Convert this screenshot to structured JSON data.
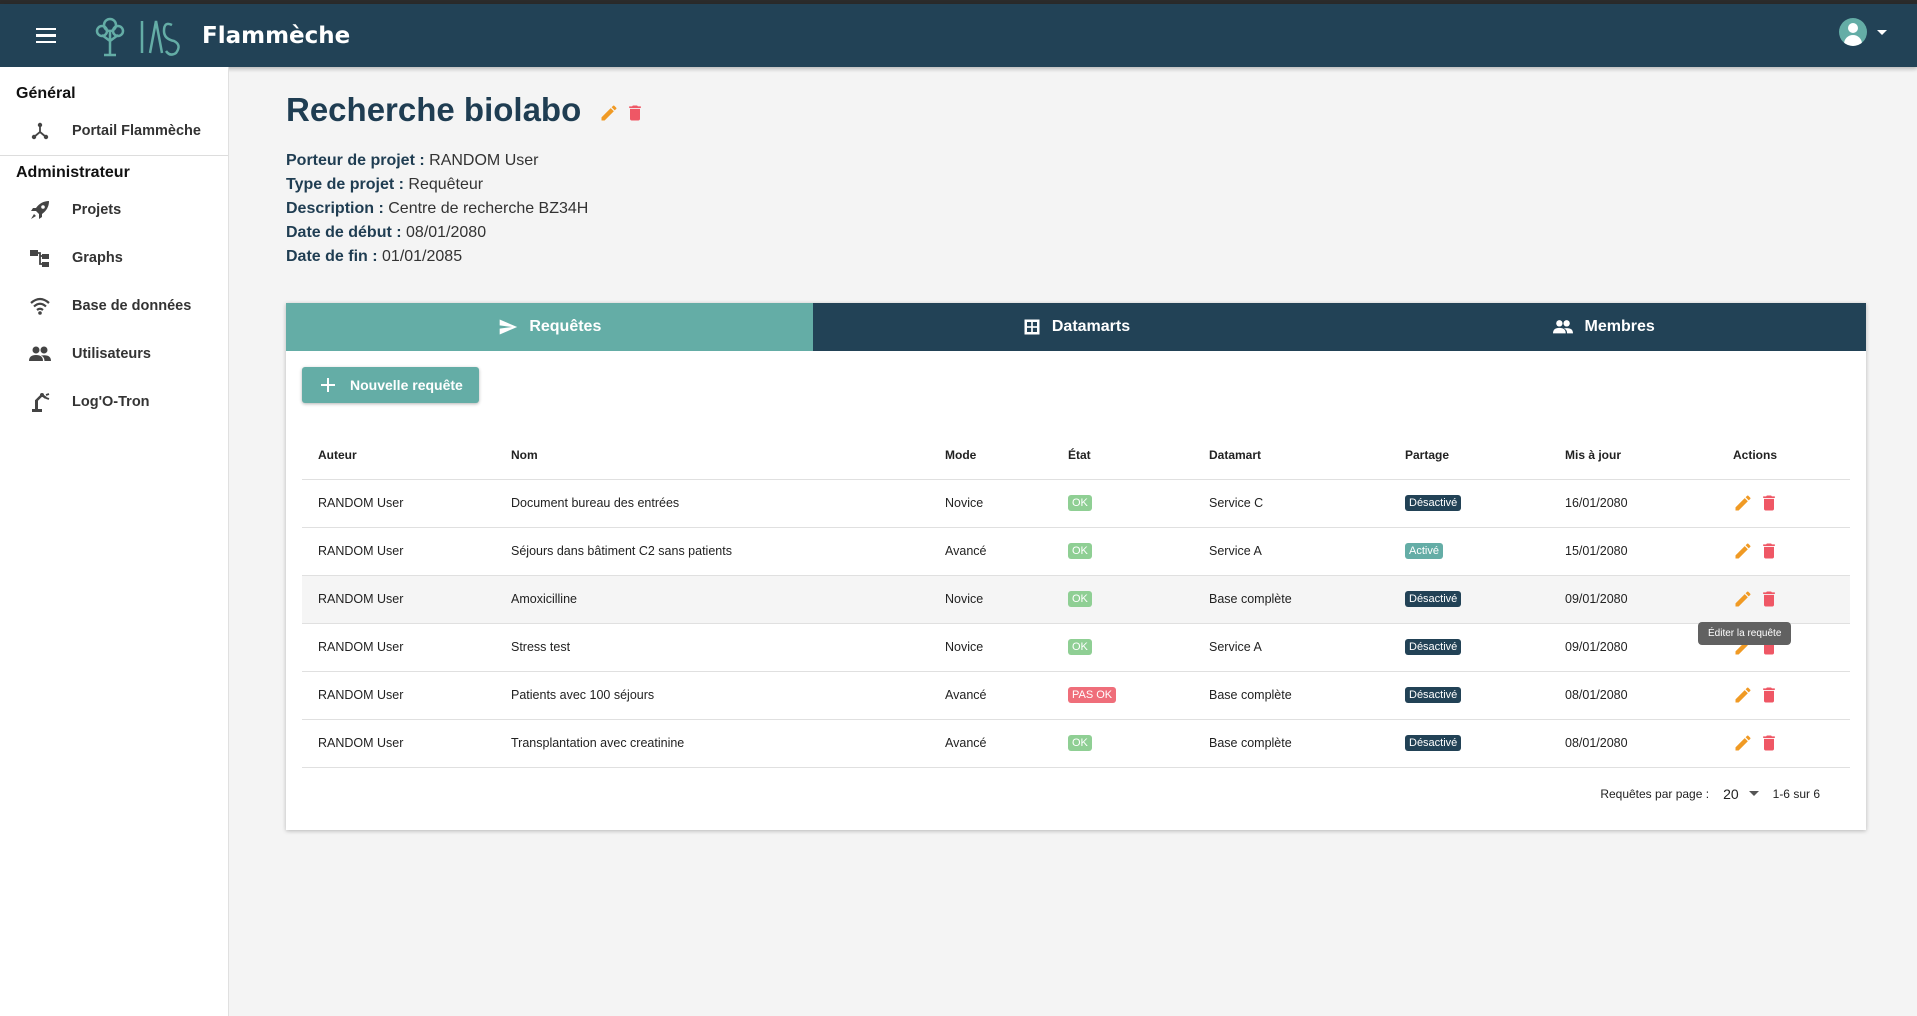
{
  "appbar": {
    "title": "Flammèche"
  },
  "sidebar": {
    "sections": [
      {
        "label": "Général",
        "items": [
          {
            "label": "Portail Flammèche",
            "icon": "hub-icon"
          }
        ]
      },
      {
        "label": "Administrateur",
        "items": [
          {
            "label": "Projets",
            "icon": "rocket-icon"
          },
          {
            "label": "Graphs",
            "icon": "graph-icon"
          },
          {
            "label": "Base de données",
            "icon": "wifi-icon"
          },
          {
            "label": "Utilisateurs",
            "icon": "users-icon"
          },
          {
            "label": "Log'O-Tron",
            "icon": "robot-arm-icon"
          }
        ]
      }
    ]
  },
  "project": {
    "title": "Recherche biolabo",
    "fields": [
      {
        "label": "Porteur de projet :",
        "value": "RANDOM User"
      },
      {
        "label": "Type de projet :",
        "value": "Requêteur"
      },
      {
        "label": "Description :",
        "value": "Centre de recherche BZ34H"
      },
      {
        "label": "Date de début :",
        "value": "08/01/2080"
      },
      {
        "label": "Date de fin :",
        "value": "01/01/2085"
      }
    ]
  },
  "tabs": [
    {
      "label": "Requêtes",
      "icon": "send-icon",
      "active": true
    },
    {
      "label": "Datamarts",
      "icon": "grid-icon",
      "active": false
    },
    {
      "label": "Membres",
      "icon": "group-icon",
      "active": false
    }
  ],
  "new_button": "Nouvelle requête",
  "table": {
    "columns": [
      "Auteur",
      "Nom",
      "Mode",
      "État",
      "Datamart",
      "Partage",
      "Mis à jour",
      "Actions"
    ],
    "rows": [
      {
        "author": "RANDOM User",
        "name": "Document bureau des entrées",
        "mode": "Novice",
        "state": "OK",
        "state_ok": true,
        "datamart": "Service C",
        "share": "Désactivé",
        "share_on": false,
        "updated": "16/01/2080"
      },
      {
        "author": "RANDOM User",
        "name": "Séjours dans bâtiment C2 sans patients",
        "mode": "Avancé",
        "state": "OK",
        "state_ok": true,
        "datamart": "Service A",
        "share": "Activé",
        "share_on": true,
        "updated": "15/01/2080"
      },
      {
        "author": "RANDOM User",
        "name": "Amoxicilline",
        "mode": "Novice",
        "state": "OK",
        "state_ok": true,
        "datamart": "Base complète",
        "share": "Désactivé",
        "share_on": false,
        "updated": "09/01/2080"
      },
      {
        "author": "RANDOM User",
        "name": "Stress test",
        "mode": "Novice",
        "state": "OK",
        "state_ok": true,
        "datamart": "Service A",
        "share": "Désactivé",
        "share_on": false,
        "updated": "09/01/2080"
      },
      {
        "author": "RANDOM User",
        "name": "Patients avec 100 séjours",
        "mode": "Avancé",
        "state": "PAS OK",
        "state_ok": false,
        "datamart": "Base complète",
        "share": "Désactivé",
        "share_on": false,
        "updated": "08/01/2080"
      },
      {
        "author": "RANDOM User",
        "name": "Transplantation avec creatinine",
        "mode": "Avancé",
        "state": "OK",
        "state_ok": true,
        "datamart": "Base complète",
        "share": "Désactivé",
        "share_on": false,
        "updated": "08/01/2080"
      }
    ]
  },
  "tooltip": "Éditer la requête",
  "pagination": {
    "label": "Requêtes par page :",
    "per_page": "20",
    "range": "1-6 sur 6"
  },
  "colors": {
    "primary": "#224256",
    "accent": "#64ada6",
    "edit": "#f09a24",
    "delete": "#ef5765",
    "ok": "#8fcf94",
    "nok": "#ef6e7a"
  }
}
